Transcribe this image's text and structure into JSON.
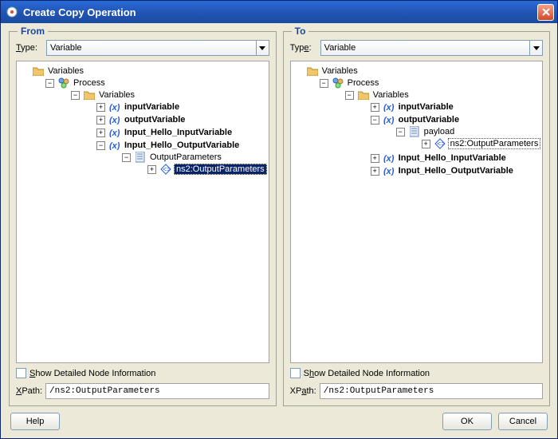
{
  "window": {
    "title": "Create Copy Operation"
  },
  "from": {
    "title": "From",
    "type_label": "Type:",
    "type_value": "Variable",
    "variables_root": "Variables",
    "process": "Process",
    "variables_inner": "Variables",
    "items": {
      "inputVariable": "inputVariable",
      "outputVariable": "outputVariable",
      "inHello": "Input_Hello_InputVariable",
      "outHello": "Input_Hello_OutputVariable",
      "outParams": "OutputParameters",
      "ns2": "ns2:OutputParameters"
    },
    "show_detail_label": "Show Detailed Node Information",
    "xpath_label": "XPath:",
    "xpath_value": "/ns2:OutputParameters"
  },
  "to": {
    "title": "To",
    "type_label": "Type:",
    "type_value": "Variable",
    "variables_root": "Variables",
    "process": "Process",
    "variables_inner": "Variables",
    "items": {
      "inputVariable": "inputVariable",
      "outputVariable": "outputVariable",
      "payload": "payload",
      "ns2": "ns2:OutputParameters",
      "inHello": "Input_Hello_InputVariable",
      "outHello": "Input_Hello_OutputVariable"
    },
    "show_detail_label": "Show Detailed Node Information",
    "xpath_label": "XPath:",
    "xpath_value": "/ns2:OutputParameters"
  },
  "buttons": {
    "help": "Help",
    "ok": "OK",
    "cancel": "Cancel"
  }
}
